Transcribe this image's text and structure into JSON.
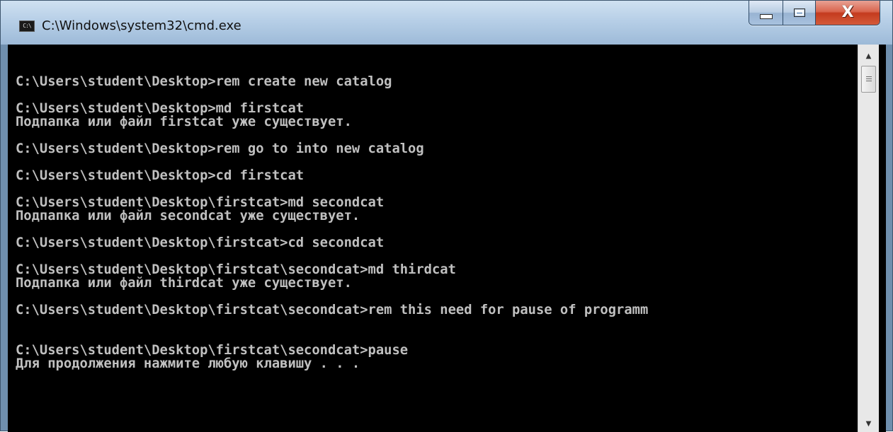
{
  "window": {
    "title": "C:\\Windows\\system32\\cmd.exe",
    "icon": "cmd-icon",
    "icon_text": "C:\\"
  },
  "controls": {
    "minimize_icon": "minimize-icon",
    "maximize_icon": "maximize-icon",
    "close_icon": "close-icon",
    "close_glyph": "X"
  },
  "colors": {
    "console_bg": "#000000",
    "console_fg": "#c0c0c0",
    "close_button": "#c43b1e",
    "titlebar": "#b7cfe7"
  },
  "console": {
    "lines": [
      "",
      "C:\\Users\\student\\Desktop>rem create new catalog",
      "",
      "C:\\Users\\student\\Desktop>md firstcat",
      "Подпапка или файл firstcat уже существует.",
      "",
      "C:\\Users\\student\\Desktop>rem go to into new catalog",
      "",
      "C:\\Users\\student\\Desktop>cd firstcat",
      "",
      "C:\\Users\\student\\Desktop\\firstcat>md secondcat",
      "Подпапка или файл secondcat уже существует.",
      "",
      "C:\\Users\\student\\Desktop\\firstcat>cd secondcat",
      "",
      "C:\\Users\\student\\Desktop\\firstcat\\secondcat>md thirdcat",
      "Подпапка или файл thirdcat уже существует.",
      "",
      "C:\\Users\\student\\Desktop\\firstcat\\secondcat>rem this need for pause of programm",
      "",
      "",
      "C:\\Users\\student\\Desktop\\firstcat\\secondcat>pause",
      "Для продолжения нажмите любую клавишу . . ."
    ]
  },
  "scrollbar": {
    "up_glyph": "▲",
    "down_glyph": "▼"
  }
}
